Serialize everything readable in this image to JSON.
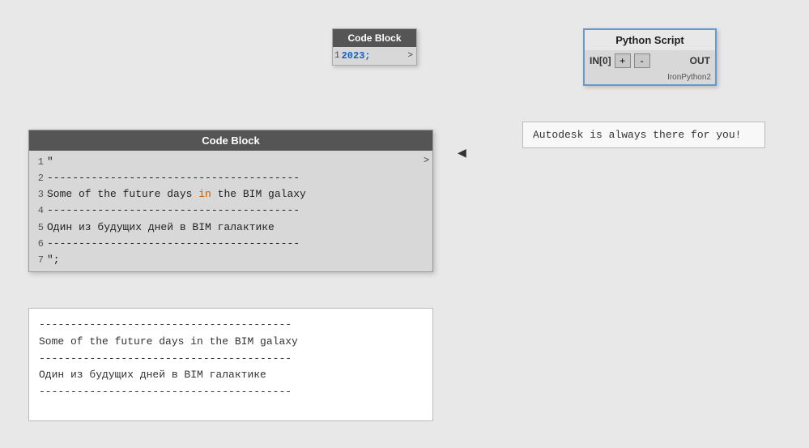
{
  "smallCodeBlock": {
    "header": "Code Block",
    "lineNum": "1",
    "codeText": "2023;",
    "arrow": ">"
  },
  "pythonScript": {
    "header": "Python Script",
    "inLabel": "IN[0]",
    "plusBtn": "+",
    "minusBtn": "-",
    "outLabel": "OUT",
    "footer": "IronPython2"
  },
  "outputBox": {
    "text": "Autodesk is always there for you!"
  },
  "largeCodeBlock": {
    "header": "Code Block",
    "arrow": ">",
    "lines": [
      {
        "num": "1",
        "text": "\""
      },
      {
        "num": "2",
        "text": "----------------------------------------"
      },
      {
        "num": "3",
        "text": "Some of the future days in the BIM galaxy",
        "hasKeyword": true,
        "keywordWord": "in"
      },
      {
        "num": "4",
        "text": "----------------------------------------"
      },
      {
        "num": "5",
        "text": "Один из будущих дней в BIM галактике"
      },
      {
        "num": "6",
        "text": "----------------------------------------"
      },
      {
        "num": "7",
        "text": "\";"
      }
    ]
  },
  "outputTextArea": {
    "lines": [
      "----------------------------------------",
      "Some of the future days in the BIM galaxy",
      "----------------------------------------",
      "Один из будущих дней в BIM галактике",
      "----------------------------------------"
    ]
  }
}
